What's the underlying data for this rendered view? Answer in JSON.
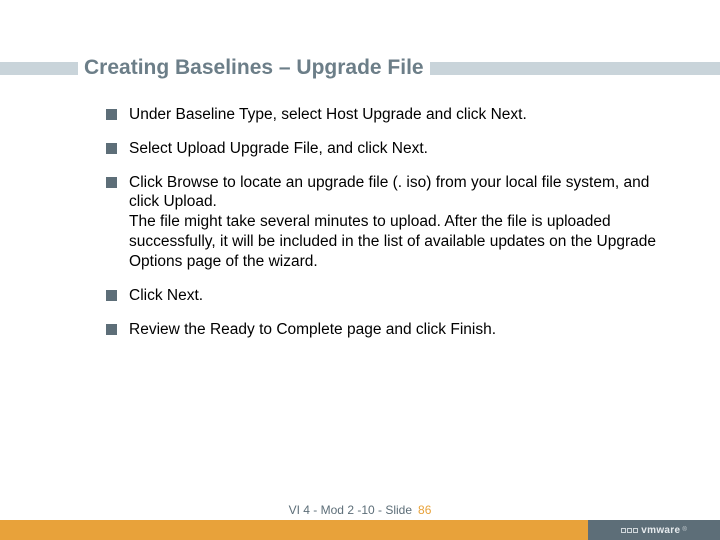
{
  "title": "Creating Baselines – Upgrade File",
  "bullets": [
    "Under Baseline Type, select Host Upgrade and click Next.",
    "Select Upload Upgrade File, and click Next.",
    "Click Browse to locate an upgrade file (. iso) from your local file system, and click Upload.\nThe file might take several minutes to upload. After the file is uploaded successfully, it will be included in the list of available updates on the Upgrade Options page of the wizard.",
    "Click Next.",
    "Review the Ready to Complete page and click Finish."
  ],
  "footer": {
    "slide_label": "VI 4 - Mod 2 -10 - Slide",
    "slide_number": "86",
    "logo_text": "vmware"
  }
}
